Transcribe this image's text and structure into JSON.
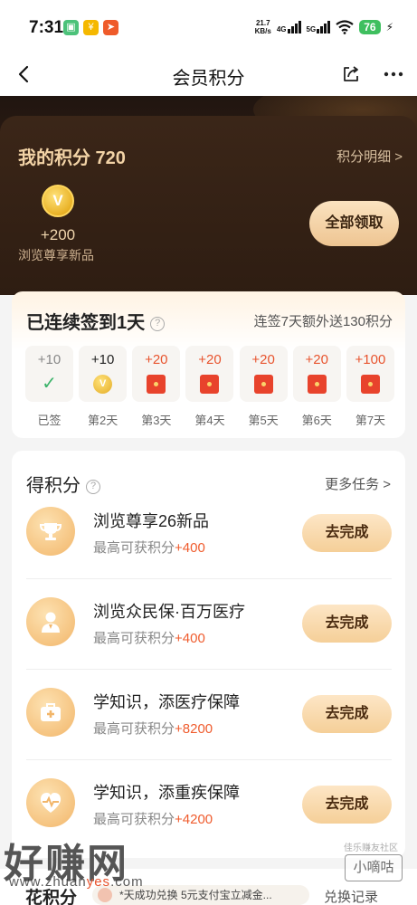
{
  "status_bar": {
    "time": "7:31",
    "app_icons": [
      {
        "name": "gallery-app-icon",
        "color": "#4cc27a",
        "glyph": "▣"
      },
      {
        "name": "yuan-app-icon",
        "color": "#f5b800",
        "glyph": "¥"
      },
      {
        "name": "send-app-icon",
        "color": "#ef5b2a",
        "glyph": "➤"
      }
    ],
    "speed_value": "21.7",
    "speed_unit": "KB/s",
    "network_1": "4G",
    "network_2": "5G",
    "battery": "76",
    "charging_icon": "⚡"
  },
  "nav": {
    "title": "会员积分"
  },
  "hero": {
    "points_title": "我的积分 720",
    "detail_link": "积分明细 >",
    "coin_glyph": "V",
    "coin_amount": "+200",
    "coin_label": "浏览尊享新品",
    "claim_all": "全部领取"
  },
  "checkin": {
    "title": "已连续签到1天",
    "help_glyph": "?",
    "bonus_text": "连签7天额外送130积分",
    "days": [
      {
        "points": "+10",
        "label": "已签",
        "state": "signed",
        "icon": "check-icon"
      },
      {
        "points": "+10",
        "label": "第2天",
        "state": "today",
        "icon": "coin-icon"
      },
      {
        "points": "+20",
        "label": "第3天",
        "state": "future",
        "icon": "red-envelope-icon"
      },
      {
        "points": "+20",
        "label": "第4天",
        "state": "future",
        "icon": "red-envelope-icon"
      },
      {
        "points": "+20",
        "label": "第5天",
        "state": "future",
        "icon": "red-envelope-icon"
      },
      {
        "points": "+20",
        "label": "第6天",
        "state": "future",
        "icon": "red-envelope-icon"
      },
      {
        "points": "+100",
        "label": "第7天",
        "state": "future",
        "icon": "red-envelope-icon"
      }
    ]
  },
  "tasks": {
    "title": "得积分",
    "help_glyph": "?",
    "more": "更多任务 >",
    "items": [
      {
        "name": "浏览尊享26新品",
        "sub_prefix": "最高可获积分",
        "points": "+400",
        "button": "去完成",
        "icon": "trophy-icon"
      },
      {
        "name": "浏览众民保·百万医疗",
        "sub_prefix": "最高可获积分",
        "points": "+400",
        "button": "去完成",
        "icon": "user-icon"
      },
      {
        "name": "学知识，添医疗保障",
        "sub_prefix": "最高可获积分",
        "points": "+8200",
        "button": "去完成",
        "icon": "medical-kit-icon"
      },
      {
        "name": "学知识，添重疾保障",
        "sub_prefix": "最高可获积分",
        "points": "+4200",
        "button": "去完成",
        "icon": "heart-pulse-icon"
      }
    ]
  },
  "bottom": {
    "title": "花积分",
    "ticker": "*天成功兑换 5元支付宝立减金...",
    "exchange": "兑换记录"
  },
  "watermark": {
    "big": "好赚网",
    "url_prefix": "www.zhuan",
    "url_accent": "yes",
    "url_suffix": ".com",
    "box": "小嘀咕",
    "small": "佳乐赚友社区"
  }
}
